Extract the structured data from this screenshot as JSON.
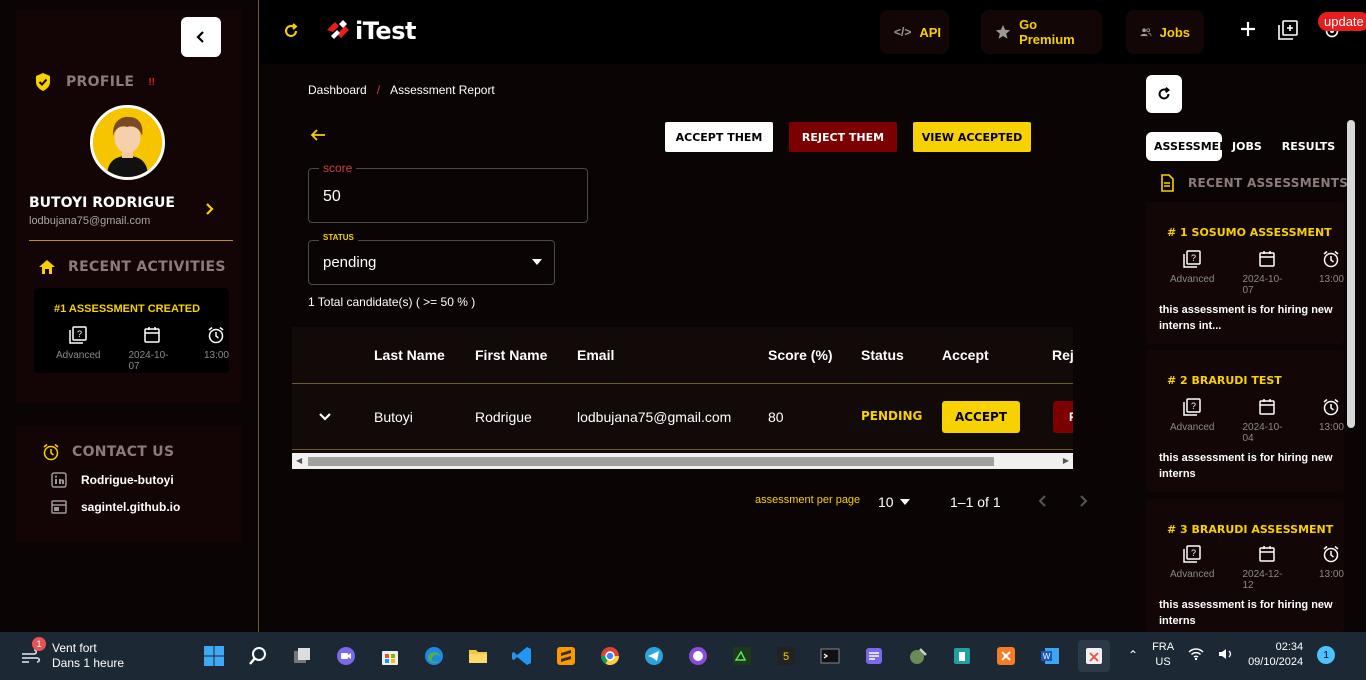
{
  "sidebar": {
    "profile_title": "PROFILE",
    "profile_flag": "!!",
    "user_name": "BUTOYI RODRIGUE",
    "user_email": "lodbujana75@gmail.com",
    "recent_title": "RECENT ACTIVITIES",
    "activity": {
      "title": "#1 ASSESSMENT CREATED",
      "level": "Advanced",
      "date": "2024-10-07",
      "time": "13:00"
    },
    "contact_title": "CONTACT US",
    "contact_links": [
      "Rodrigue-butoyi",
      "sagintel.github.io"
    ]
  },
  "topnav": {
    "logo": "iTest",
    "api_label": "API",
    "premium_label": "Go Premium",
    "jobs_label": "Jobs",
    "update_label": "update"
  },
  "main": {
    "breadcrumb": [
      "Dashboard",
      "/",
      "Assessment Report"
    ],
    "accept_them": "ACCEPT THEM",
    "reject_them": "REJECT THEM",
    "view_accepted": "VIEW ACCEPTED",
    "score_label": "score",
    "score_value": "50",
    "status_label": "STATUS",
    "status_value": "pending",
    "total_text": "1 Total candidate(s) ( >= 50 % )",
    "table": {
      "headers": [
        "Last Name",
        "First Name",
        "Email",
        "Score (%)",
        "Status",
        "Accept",
        "Rej"
      ],
      "row": {
        "last_name": "Butoyi",
        "first_name": "Rodrigue",
        "email": "lodbujana75@gmail.com",
        "score": "80",
        "status": "PENDING",
        "accept": "ACCEPT",
        "reject": "R"
      }
    },
    "pagination": {
      "per_page_label": "assessment per page",
      "per_page_value": "10",
      "range": "1–1 of 1"
    }
  },
  "right": {
    "tabs": [
      "ASSESSMENTS",
      "JOBS",
      "RESULTS"
    ],
    "recent_title": "RECENT ASSESSMENTS",
    "cards": [
      {
        "title": "# 1 SOSUMO ASSESSMENT",
        "level": "Advanced",
        "date": "2024-10-07",
        "time": "13:00",
        "desc": "this assessment is for hiring new interns int..."
      },
      {
        "title": "# 2 BRARUDI TEST",
        "level": "Advanced",
        "date": "2024-10-04",
        "time": "13:00",
        "desc": "this assessment is for hiring new interns"
      },
      {
        "title": "# 3 BRARUDI ASSESSMENT",
        "level": "Advanced",
        "date": "2024-12-12",
        "time": "13:00",
        "desc": "this assessment is for hiring new interns"
      }
    ]
  },
  "taskbar": {
    "weather_title": "Vent fort",
    "weather_sub": "Dans 1 heure",
    "weather_badge": "1",
    "lang_1": "FRA",
    "lang_2": "US",
    "time": "02:34",
    "date": "09/10/2024",
    "notif_count": "1"
  },
  "colors": {
    "accent_yellow": "#f7d100",
    "danger_red": "#7d0000",
    "background": "#0b0404"
  }
}
